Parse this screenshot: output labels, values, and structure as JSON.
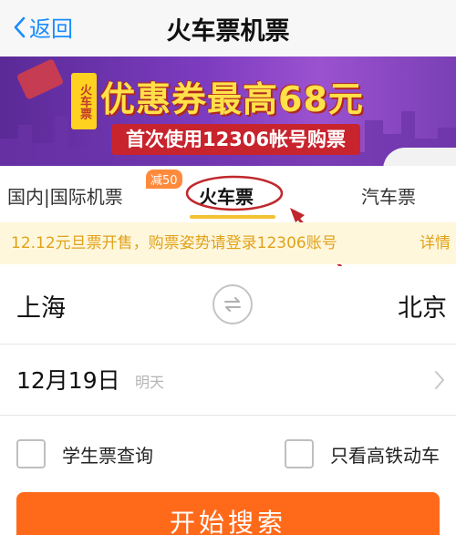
{
  "navbar": {
    "back_label": "返回",
    "title": "火车票机票"
  },
  "banner": {
    "tag": "火车票",
    "headline": "优惠券最高68元",
    "subline": "首次使用12306帐号购票"
  },
  "tabs": {
    "items": [
      {
        "label": "国内|国际机票"
      },
      {
        "label": "火车票",
        "active": true
      },
      {
        "label": "汽车票"
      }
    ],
    "badge": "减50"
  },
  "notice": {
    "text": "12.12元旦票开售，购票姿势请登录12306账号",
    "more": "详情"
  },
  "route": {
    "from": "上海",
    "to": "北京"
  },
  "date": {
    "value": "12月19日",
    "hint": "明天"
  },
  "options": {
    "student_label": "学生票查询",
    "high_speed_label": "只看高铁动车"
  },
  "search_label": "开始搜索",
  "colors": {
    "accent": "#1a8cff",
    "search_button": "#ff6a1a",
    "tab_underline": "#f1c232",
    "notice_text": "#e0a21a",
    "annotation": "#c0282d"
  }
}
